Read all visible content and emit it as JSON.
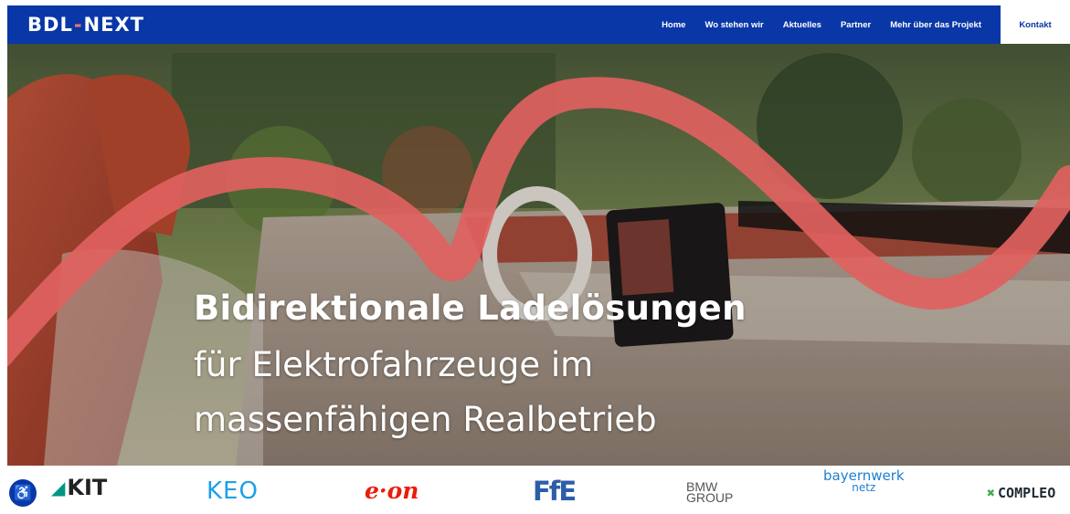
{
  "header": {
    "logo": {
      "part1": "BDL",
      "dash": "-",
      "part2": "N",
      "part3": "EXT"
    },
    "nav": [
      "Home",
      "Wo stehen wir",
      "Aktuelles",
      "Partner",
      "Mehr über das Projekt"
    ],
    "kontakt": "Kontakt"
  },
  "hero": {
    "title": "Bidirektionale Ladelösungen",
    "subtitle_line1": "für Elektrofahrzeuge im",
    "subtitle_line2": "massenfähigen Realbetrieb"
  },
  "partners": {
    "accessibility_icon": "accessibility-icon",
    "kit": "KIT",
    "keo": "KEO",
    "eon": "e·on",
    "ffe": "FfE",
    "bmw_line1": "BMW",
    "bmw_line2": "GROUP",
    "bayernwerk_line1": "bayernwerk",
    "bayernwerk_line2": "netz",
    "compleo": "COMPLEO"
  },
  "colors": {
    "brand_blue": "#0a37a7",
    "wave_coral": "#ff6f6c",
    "white": "#ffffff"
  }
}
